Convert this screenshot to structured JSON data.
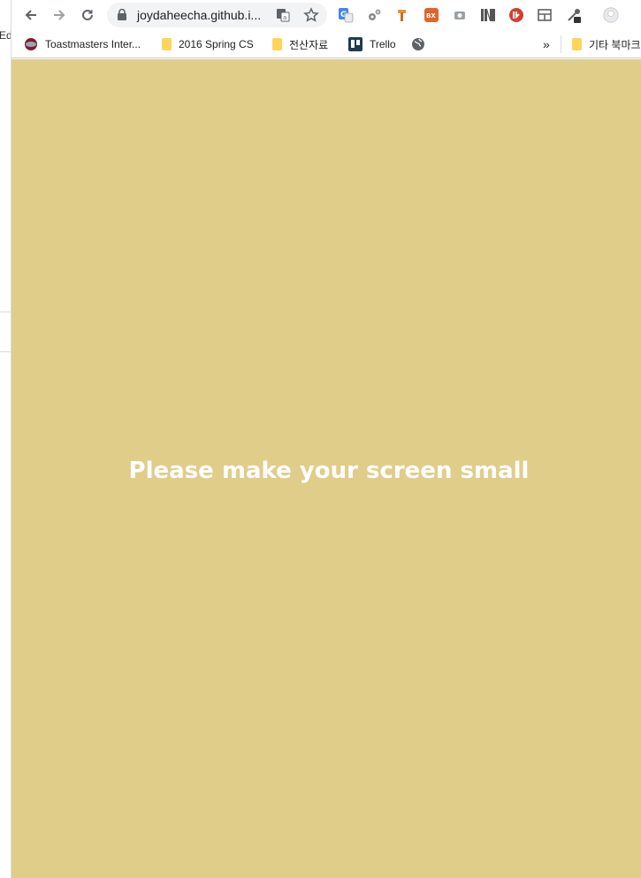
{
  "background_window": {
    "edge_text": "Edi"
  },
  "toolbar": {
    "back_label": "Back",
    "forward_label": "Forward",
    "reload_label": "Reload",
    "url": "joydaheecha.github.i...",
    "extensions": [
      "google-translate-icon",
      "gears-icon",
      "hammer-icon",
      "bx-extension-icon",
      "camera-icon",
      "wn-extension-icon",
      "red-extension-icon",
      "layout-icon",
      "eyedropper-icon",
      "profile-icon"
    ]
  },
  "bookmarks": {
    "items": [
      {
        "label": "Toastmasters Inter...",
        "icon": "toastmasters-icon"
      },
      {
        "label": "2016 Spring CS",
        "icon": "folder-icon"
      },
      {
        "label": "전산자료",
        "icon": "folder-icon"
      },
      {
        "label": "Trello",
        "icon": "trello-icon"
      },
      {
        "label": "",
        "icon": "globe-icon"
      }
    ],
    "overflow_label": "»",
    "other_bookmarks_label": "기타 북마크"
  },
  "page": {
    "heading": "Please make your screen small",
    "background_color": "#e0cd8a",
    "text_color": "#ffffff"
  }
}
